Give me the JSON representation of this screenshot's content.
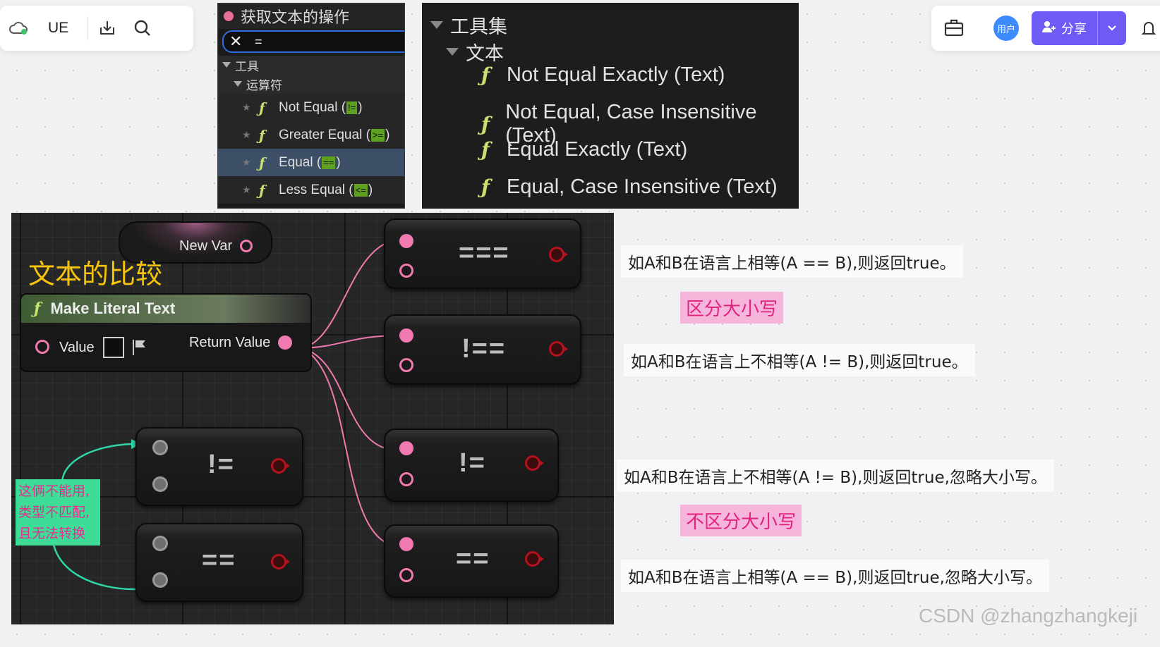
{
  "left_toolbar": {
    "doc_title": "UE",
    "icons": [
      "cloud-sync-icon",
      "download-icon",
      "search-icon"
    ]
  },
  "right_toolbar": {
    "avatar_text": "用户",
    "share_label": "分享",
    "icons": [
      "briefcase-icon",
      "add-user-icon",
      "chevron-down-icon",
      "bell-icon"
    ]
  },
  "action_menu": {
    "title": "获取文本的操作",
    "search_value": "=",
    "category": "工具",
    "subcategory": "运算符",
    "items": [
      {
        "label": "Not Equal (",
        "op": "!=",
        "suffix": ")"
      },
      {
        "label": "Greater Equal (",
        "op": ">=",
        "suffix": ")"
      },
      {
        "label": "Equal (",
        "op": "==",
        "suffix": ")"
      },
      {
        "label": "Less Equal (",
        "op": "<=",
        "suffix": ")"
      }
    ]
  },
  "toolset": {
    "category": "工具集",
    "subcategory": "文本",
    "items": [
      "Not Equal Exactly (Text)",
      "Not Equal, Case Insensitive (Text)",
      "Equal Exactly (Text)",
      "Equal, Case Insensitive (Text)"
    ]
  },
  "blueprint": {
    "title": "文本的比较",
    "new_var_label": "New Var",
    "make_literal_title": "Make Literal Text",
    "value_label": "Value",
    "return_label": "Return Value",
    "ops": {
      "not_equal_exactly": "!==",
      "equal_exactly": "===",
      "not_equal_ci": "!=",
      "equal_ci": "==",
      "bad_not_equal": "!=",
      "bad_equal": "=="
    },
    "note": [
      "这俩不能用,",
      "类型不匹配,",
      "且无法转换"
    ]
  },
  "annotations": {
    "equal_exactly": "如A和B在语言上相等(A == B),则返回true。",
    "case_sensitive_tag": "区分大小写",
    "not_equal_exactly": "如A和B在语言上不相等(A != B),则返回true。",
    "not_equal_ci": "如A和B在语言上不相等(A != B),则返回true,忽略大小写。",
    "case_insensitive_tag": "不区分大小写",
    "equal_ci": "如A和B在语言上相等(A == B),则返回true,忽略大小写。"
  },
  "watermark": "CSDN @zhangzhangkeji",
  "colors": {
    "share_button": "#6e5bf5",
    "avatar": "#3d8bff",
    "wire": "#f07ab0",
    "title_yellow": "#f6c40a",
    "note_green": "#3ddc97",
    "tag_pink_bg": "#f6b6dc",
    "tag_pink_text": "#e1237f"
  }
}
